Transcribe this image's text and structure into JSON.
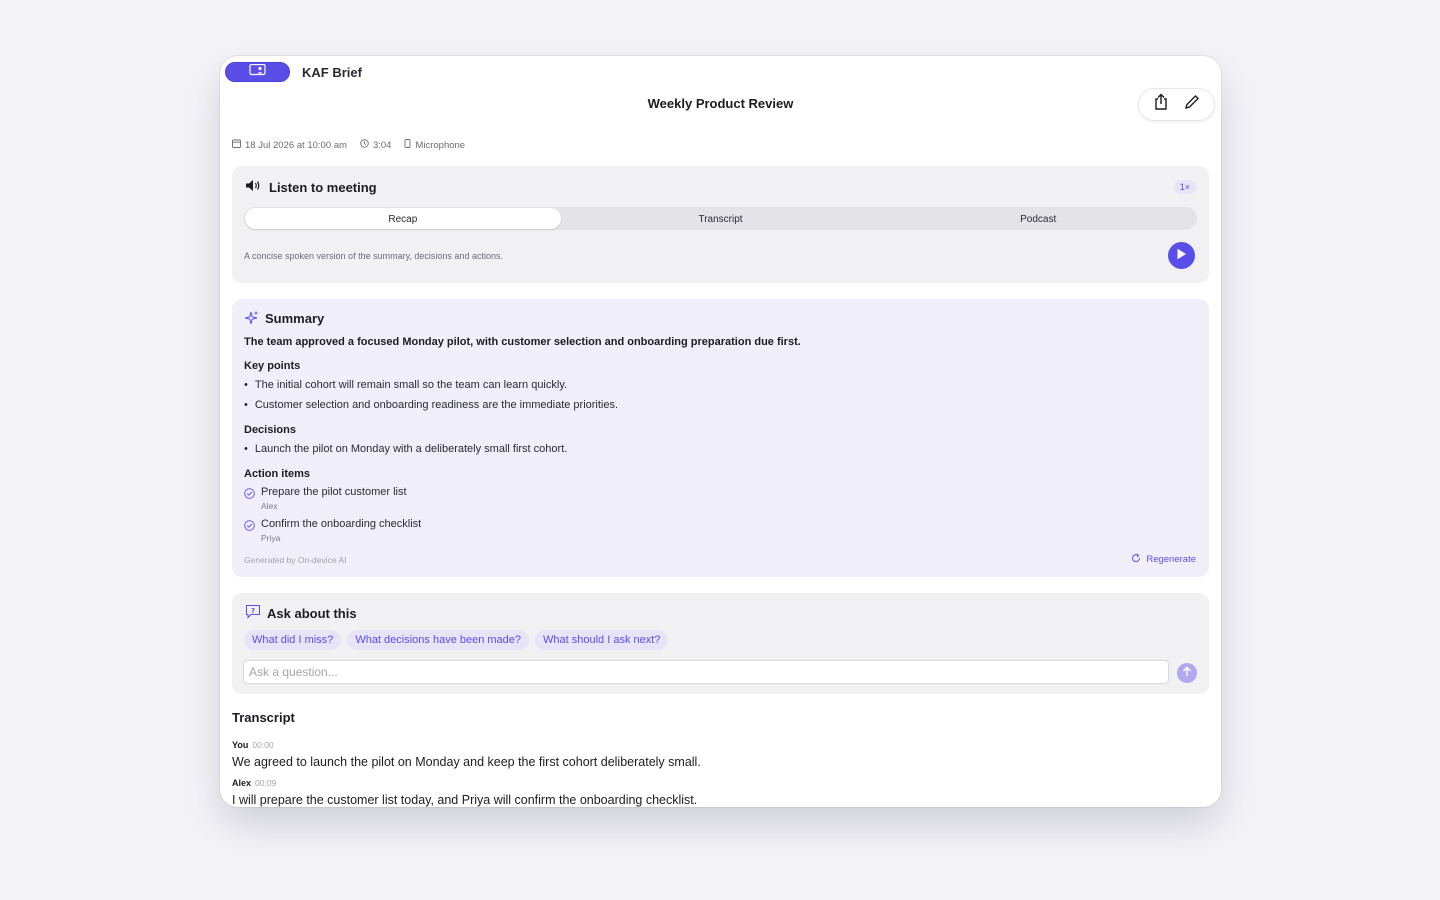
{
  "app": {
    "name": "KAF Brief"
  },
  "meeting": {
    "title": "Weekly Product Review",
    "date": "18 Jul 2026 at 10:00 am",
    "duration": "3:04",
    "source": "Microphone"
  },
  "toolbar": {
    "share_icon": "share-icon",
    "edit_icon": "pencil-icon"
  },
  "listen": {
    "heading": "Listen to meeting",
    "speed": "1×",
    "tabs": [
      "Recap",
      "Transcript",
      "Podcast"
    ],
    "active_tab": "Recap",
    "description": "A concise spoken version of the summary, decisions and actions."
  },
  "summary": {
    "heading": "Summary",
    "lead": "The team approved a focused Monday pilot, with customer selection and onboarding preparation due first.",
    "key_points_heading": "Key points",
    "key_points": [
      "The initial cohort will remain small so the team can learn quickly.",
      "Customer selection and onboarding readiness are the immediate priorities."
    ],
    "decisions_heading": "Decisions",
    "decisions": [
      "Launch the pilot on Monday with a deliberately small first cohort."
    ],
    "action_items_heading": "Action items",
    "action_items": [
      {
        "text": "Prepare the pilot customer list",
        "owner": "Alex"
      },
      {
        "text": "Confirm the onboarding checklist",
        "owner": "Priya"
      }
    ],
    "generated_by": "Generated by On-device AI",
    "regenerate_label": "Regenerate"
  },
  "ask": {
    "heading": "Ask about this",
    "suggestions": [
      "What did I miss?",
      "What decisions have been made?",
      "What should I ask next?"
    ],
    "placeholder": "Ask a question...",
    "value": ""
  },
  "transcript": {
    "heading": "Transcript",
    "lines": [
      {
        "speaker": "You",
        "time": "00:00",
        "text": "We agreed to launch the pilot on Monday and keep the first cohort deliberately small."
      },
      {
        "speaker": "Alex",
        "time": "00:09",
        "text": "I will prepare the customer list today, and Priya will confirm the onboarding checklist."
      }
    ]
  },
  "colors": {
    "accent": "#5b4ee8",
    "summary_bg": "#f0eff9",
    "card_bg": "#f1f1f4"
  }
}
